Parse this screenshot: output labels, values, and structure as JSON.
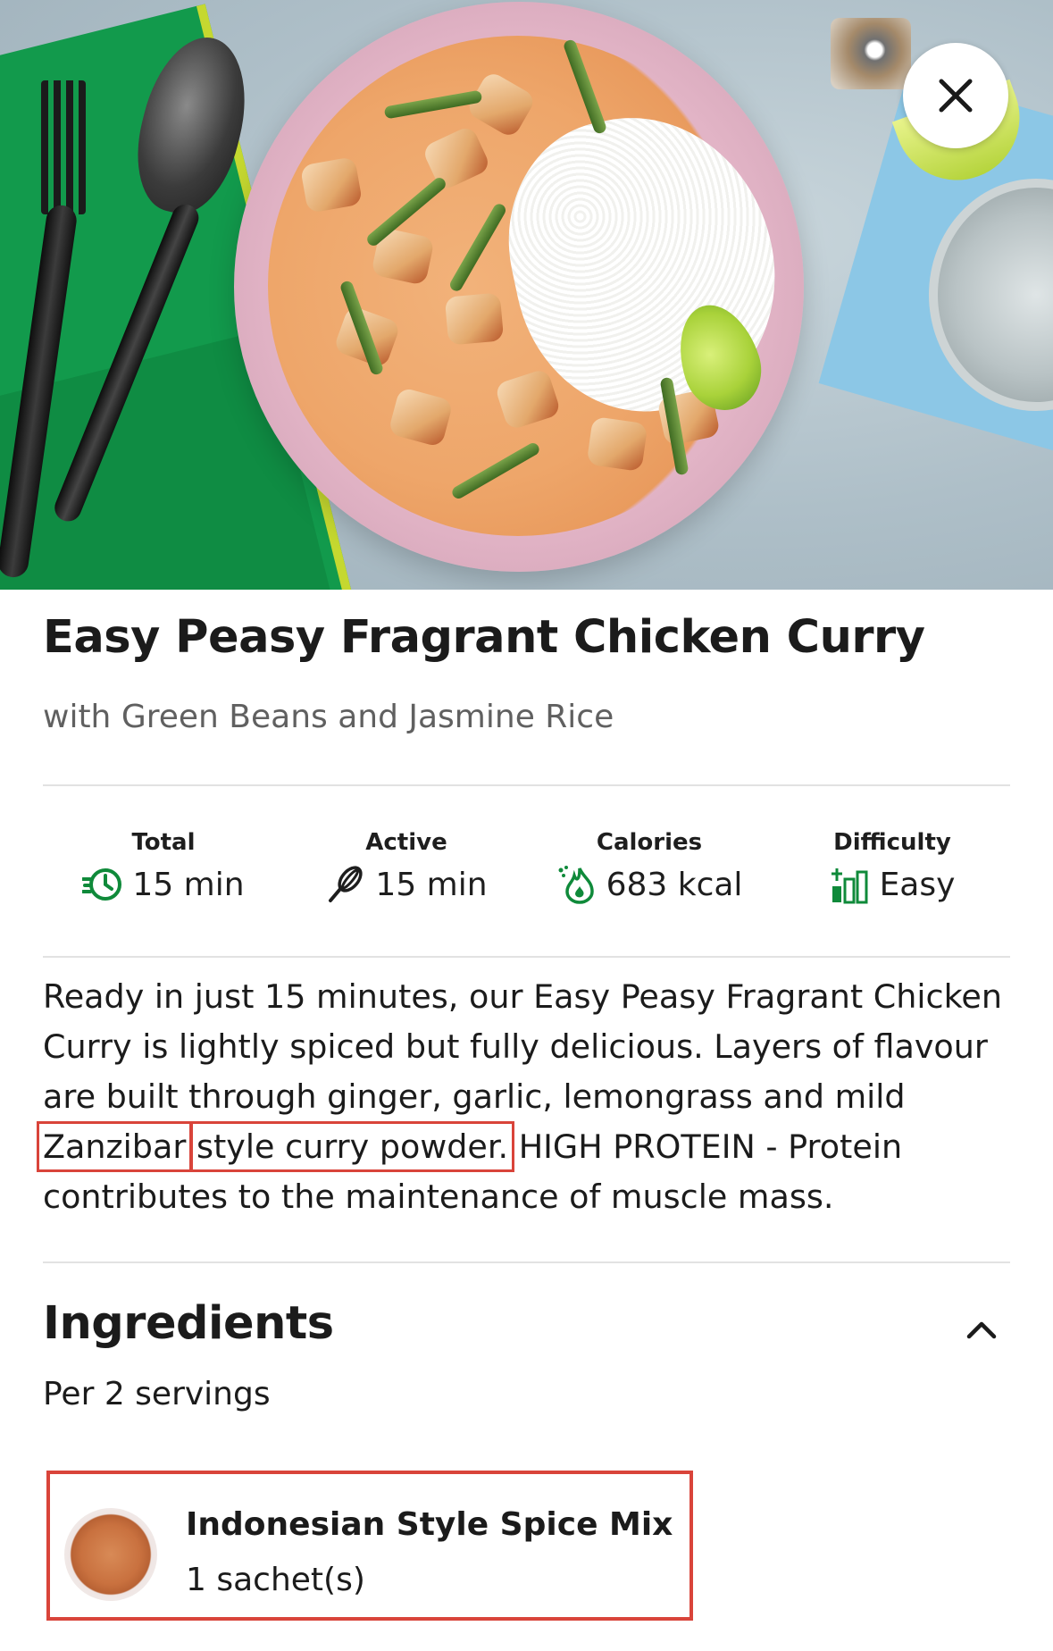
{
  "hero": {
    "image_alt": ""
  },
  "recipe": {
    "title": "Easy Peasy Fragrant Chicken Curry",
    "subtitle": "with Green Beans and Jasmine Rice"
  },
  "stats": [
    {
      "label": "Total",
      "value": "15 min",
      "icon": "timer-icon"
    },
    {
      "label": "Active",
      "value": "15 min",
      "icon": "whisk-icon"
    },
    {
      "label": "Calories",
      "value": "683 kcal",
      "icon": "flame-icon"
    },
    {
      "label": "Difficulty",
      "value": "Easy",
      "icon": "difficulty-bars-icon"
    }
  ],
  "description": {
    "part1": "Ready in just 15 minutes, our Easy Peasy Fragrant Chicken Curry is lightly spiced but fully delicious. Layers of flavour are built through ginger, garlic, lemongrass and mild ",
    "highlight1": "Zanzibar",
    "part2": " ",
    "highlight2": "style curry powder.",
    "part3": " HIGH PROTEIN - Protein contributes to the maintenance of muscle mass."
  },
  "ingredients": {
    "title": "Ingredients",
    "servings": "Per 2 servings",
    "items": [
      {
        "name": "Indonesian Style Spice Mix",
        "quantity": "1 sachet(s)"
      }
    ]
  },
  "colors": {
    "highlight_border": "#d9443a",
    "accent_green": "#0f8a3a",
    "text": "#1b1b1b",
    "subtext": "#606060"
  }
}
